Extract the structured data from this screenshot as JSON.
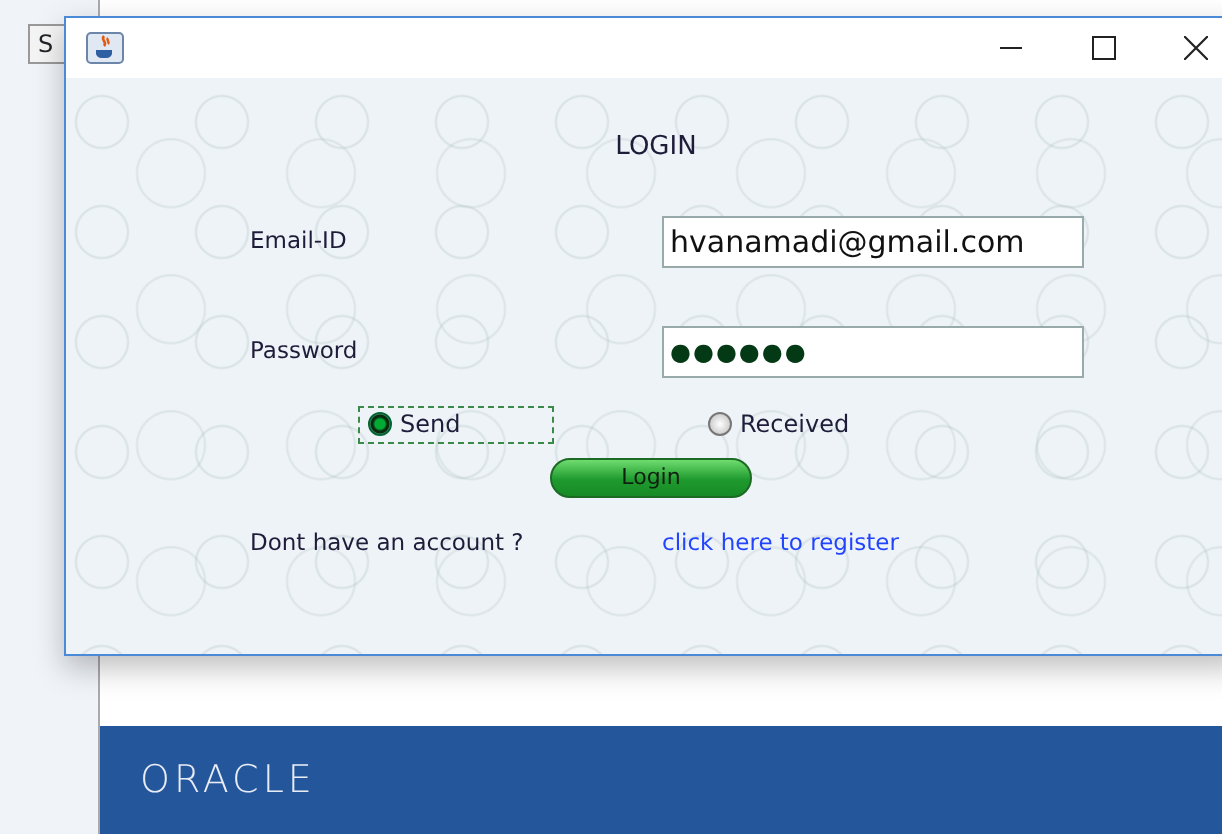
{
  "background_window": {
    "button_label": "S",
    "logo": "ORACLE"
  },
  "dialog": {
    "heading": "LOGIN",
    "fields": [
      {
        "label": "Email-ID",
        "value": "hvanamadi@gmail.com",
        "kind": "text"
      },
      {
        "label": "Password",
        "value": "●●●●●●",
        "kind": "password"
      }
    ],
    "radios": [
      {
        "label": "Send",
        "selected": true,
        "focused": true
      },
      {
        "label": "Received",
        "selected": false,
        "focused": false
      }
    ],
    "button": "Login",
    "prompt": "Dont have an account ?",
    "link": "click here to register"
  }
}
